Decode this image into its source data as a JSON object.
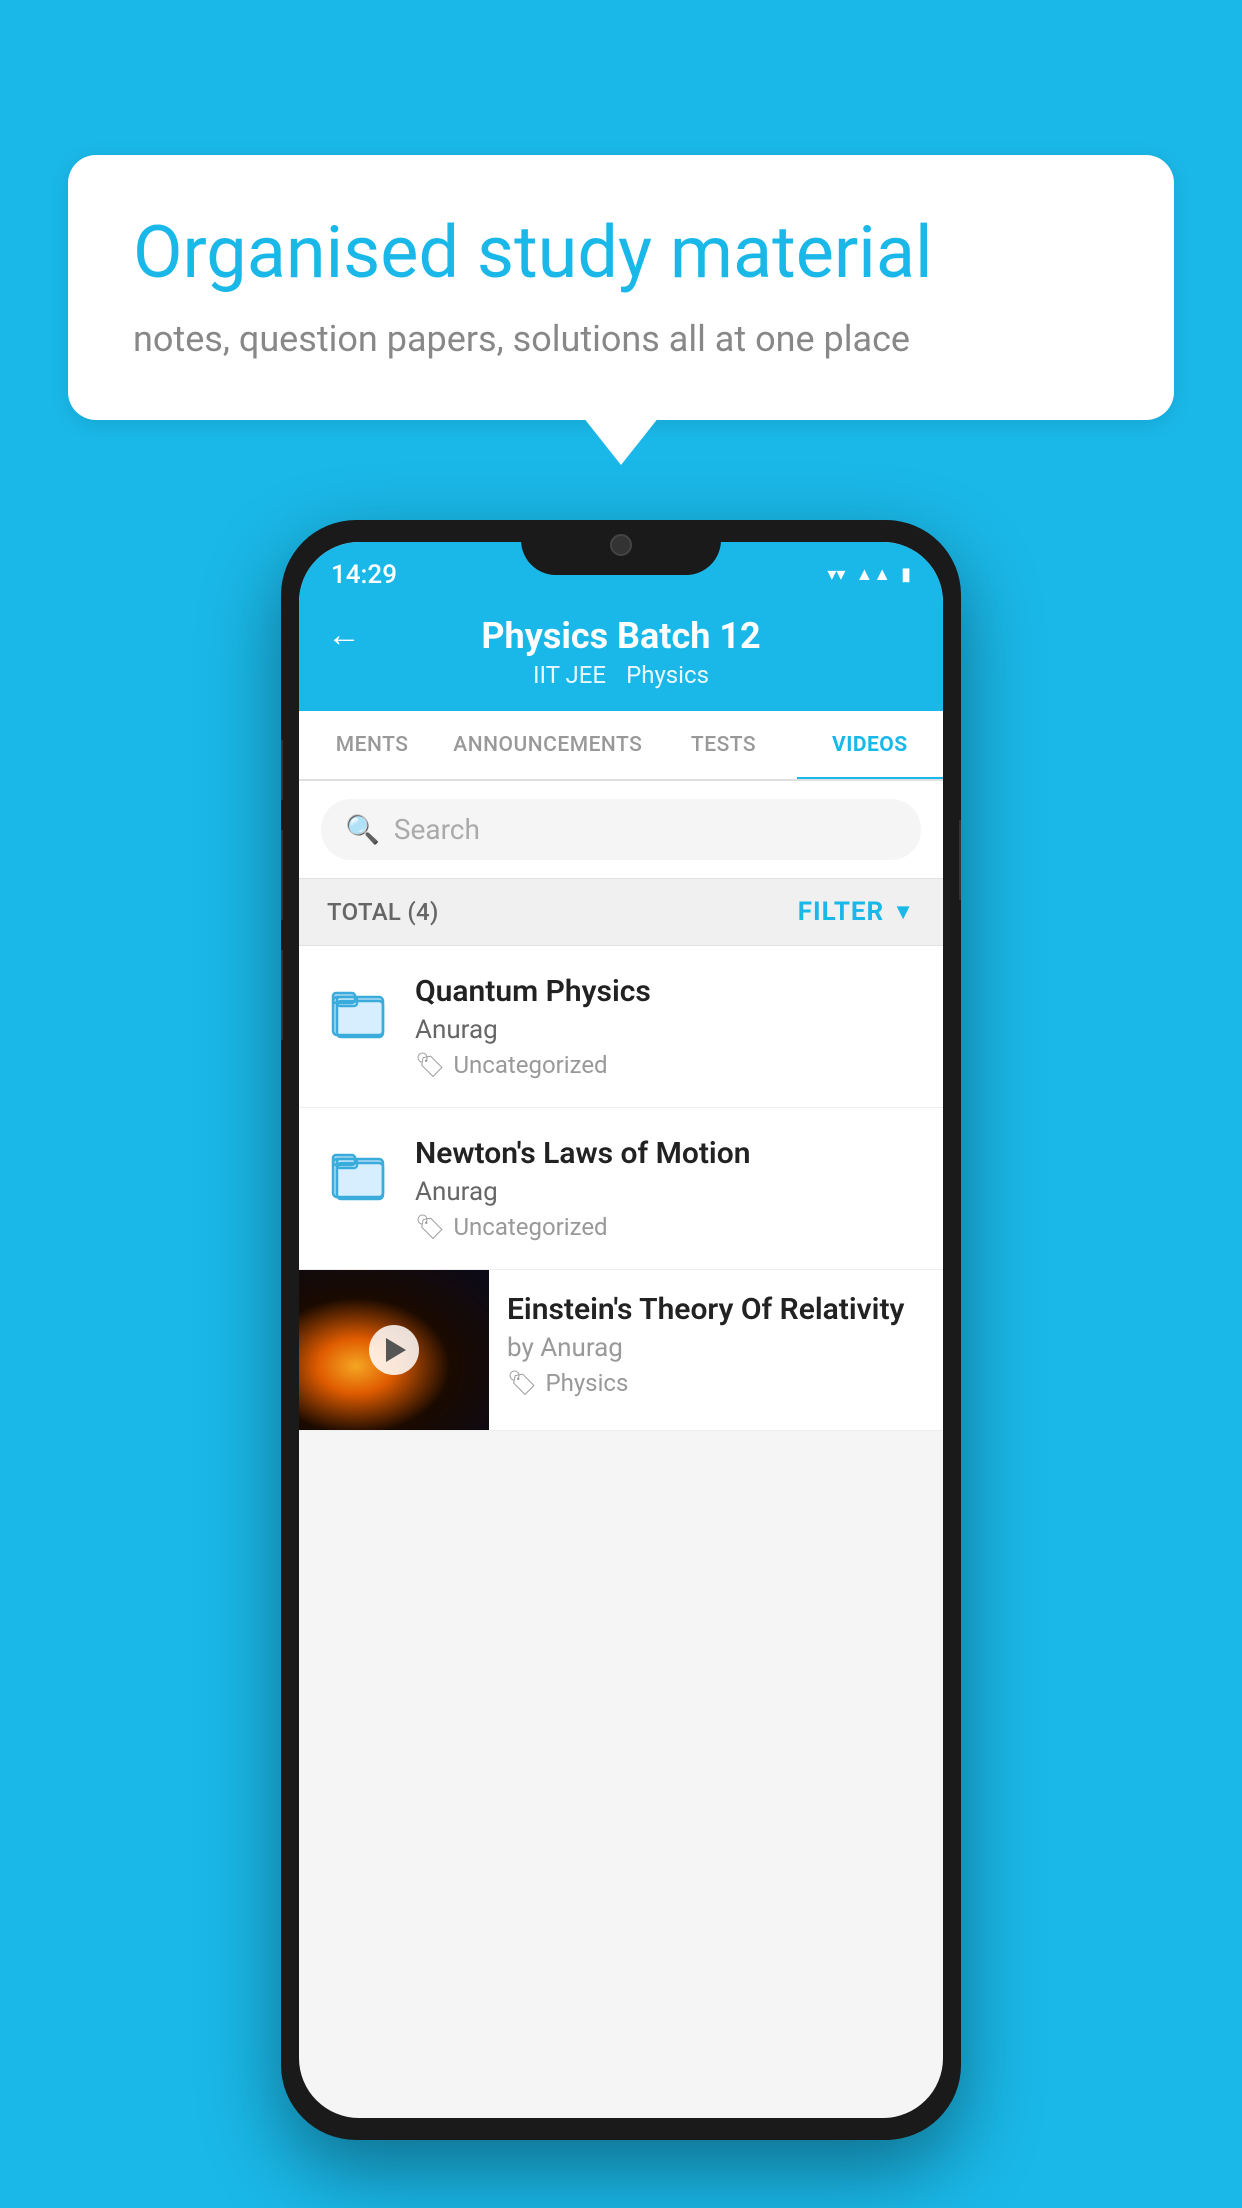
{
  "background_color": "#1ab8e8",
  "bubble": {
    "title": "Organised study material",
    "subtitle": "notes, question papers, solutions all at one place"
  },
  "phone": {
    "status_bar": {
      "time": "14:29",
      "wifi": "▼",
      "signal": "▲",
      "battery": "▮"
    },
    "header": {
      "title": "Physics Batch 12",
      "tags": [
        "IIT JEE",
        "Physics"
      ],
      "back_label": "←"
    },
    "tabs": [
      {
        "label": "MENTS",
        "active": false
      },
      {
        "label": "ANNOUNCEMENTS",
        "active": false
      },
      {
        "label": "TESTS",
        "active": false
      },
      {
        "label": "VIDEOS",
        "active": true
      }
    ],
    "search": {
      "placeholder": "Search"
    },
    "filter_bar": {
      "total_label": "TOTAL (4)",
      "filter_label": "FILTER"
    },
    "videos": [
      {
        "type": "file",
        "title": "Quantum Physics",
        "author": "Anurag",
        "tag": "Uncategorized"
      },
      {
        "type": "file",
        "title": "Newton's Laws of Motion",
        "author": "Anurag",
        "tag": "Uncategorized"
      },
      {
        "type": "video",
        "title": "Einstein's Theory Of Relativity",
        "author": "by Anurag",
        "tag": "Physics"
      }
    ]
  }
}
